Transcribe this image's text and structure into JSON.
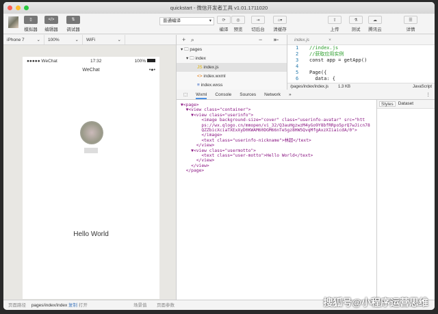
{
  "window": {
    "title": "quickstart - 微信开发者工具 v1.01.1711020"
  },
  "toolbar": {
    "left": [
      {
        "label": "模拟器",
        "icon": "phone-icon"
      },
      {
        "label": "编辑器",
        "icon": "code-icon"
      },
      {
        "label": "调试器",
        "icon": "debug-icon"
      }
    ],
    "compile_mode": "普通编译",
    "center": [
      {
        "label": "编译",
        "icon": "refresh-icon"
      },
      {
        "label": "预览",
        "icon": "eye-icon"
      },
      {
        "label": "切后台",
        "icon": "background-icon"
      },
      {
        "label": "清缓存",
        "icon": "clear-cache-icon"
      }
    ],
    "right": [
      {
        "label": "上传",
        "icon": "upload-icon"
      },
      {
        "label": "测试",
        "icon": "test-icon"
      },
      {
        "label": "腾讯云",
        "icon": "cloud-icon"
      },
      {
        "label": "详情",
        "icon": "menu-icon"
      }
    ]
  },
  "simulator": {
    "device": "iPhone 7",
    "zoom": "100%",
    "network": "WiFi",
    "carrier": "●●●●● WeChat",
    "time": "17:32",
    "battery": "100%",
    "nav_title": "WeChat",
    "motto": "Hello World"
  },
  "tree": {
    "items": [
      {
        "label": "pages",
        "level": 0
      },
      {
        "label": "index",
        "level": 1
      },
      {
        "label": "index.js",
        "level": 2,
        "selected": true
      },
      {
        "label": "index.wxml",
        "level": 2
      },
      {
        "label": "index.wxss",
        "level": 2
      }
    ]
  },
  "editor": {
    "tab": "index.js",
    "lines": [
      {
        "n": "1",
        "code": "//index.js",
        "color": "#2a9d2a"
      },
      {
        "n": "2",
        "code": "//获取应用实例",
        "color": "#2a9d2a"
      },
      {
        "n": "3",
        "code": "const app = getApp()",
        "color": "#222"
      },
      {
        "n": "4",
        "code": "",
        "color": "#222"
      },
      {
        "n": "5",
        "code": "Page({",
        "color": "#222"
      },
      {
        "n": "6",
        "code": "  data: {",
        "color": "#222"
      }
    ],
    "path": "/pages/index/index.js",
    "size": "1.3 KB",
    "lang": "JavaScript"
  },
  "devtools": {
    "tabs": [
      "Wxml",
      "Console",
      "Sources",
      "Network",
      "»"
    ],
    "side_tabs": [
      "Styles",
      "Dataset"
    ]
  },
  "wxml": [
    "▼<page>",
    "  ▼<view class=\"container\">",
    "    ▼<view class=\"userinfo\">",
    "        <image background-size=\"cover\" class=\"userinfo-avatar\" src=\"htt",
    "        ps://wx.qlogo.cn/mmopen/vi_32/Q3auHgzwzM4yGo9Y8bfRRpo5prQ7wJicn78",
    "        QZZbicXciaTXExXyD0KWAM60DGM66nTe5gz8HW5QvqMfgAxzXIiaicdA/0\">",
    "        </image>",
    "        <text class=\"userinfo-nickname\">林超</text>",
    "      </view>",
    "    ▼<view class=\"usermotto\">",
    "        <text class=\"user-motto\">Hello World</text>",
    "      </view>",
    "    </view>",
    "  </page>"
  ],
  "footer": {
    "path_label": "页面路径",
    "path": "pages/index/index",
    "copy": "复制",
    "open": "打开",
    "scene": "场景值",
    "params": "页面参数"
  },
  "watermark": "搜狐号@小程序运营思维"
}
